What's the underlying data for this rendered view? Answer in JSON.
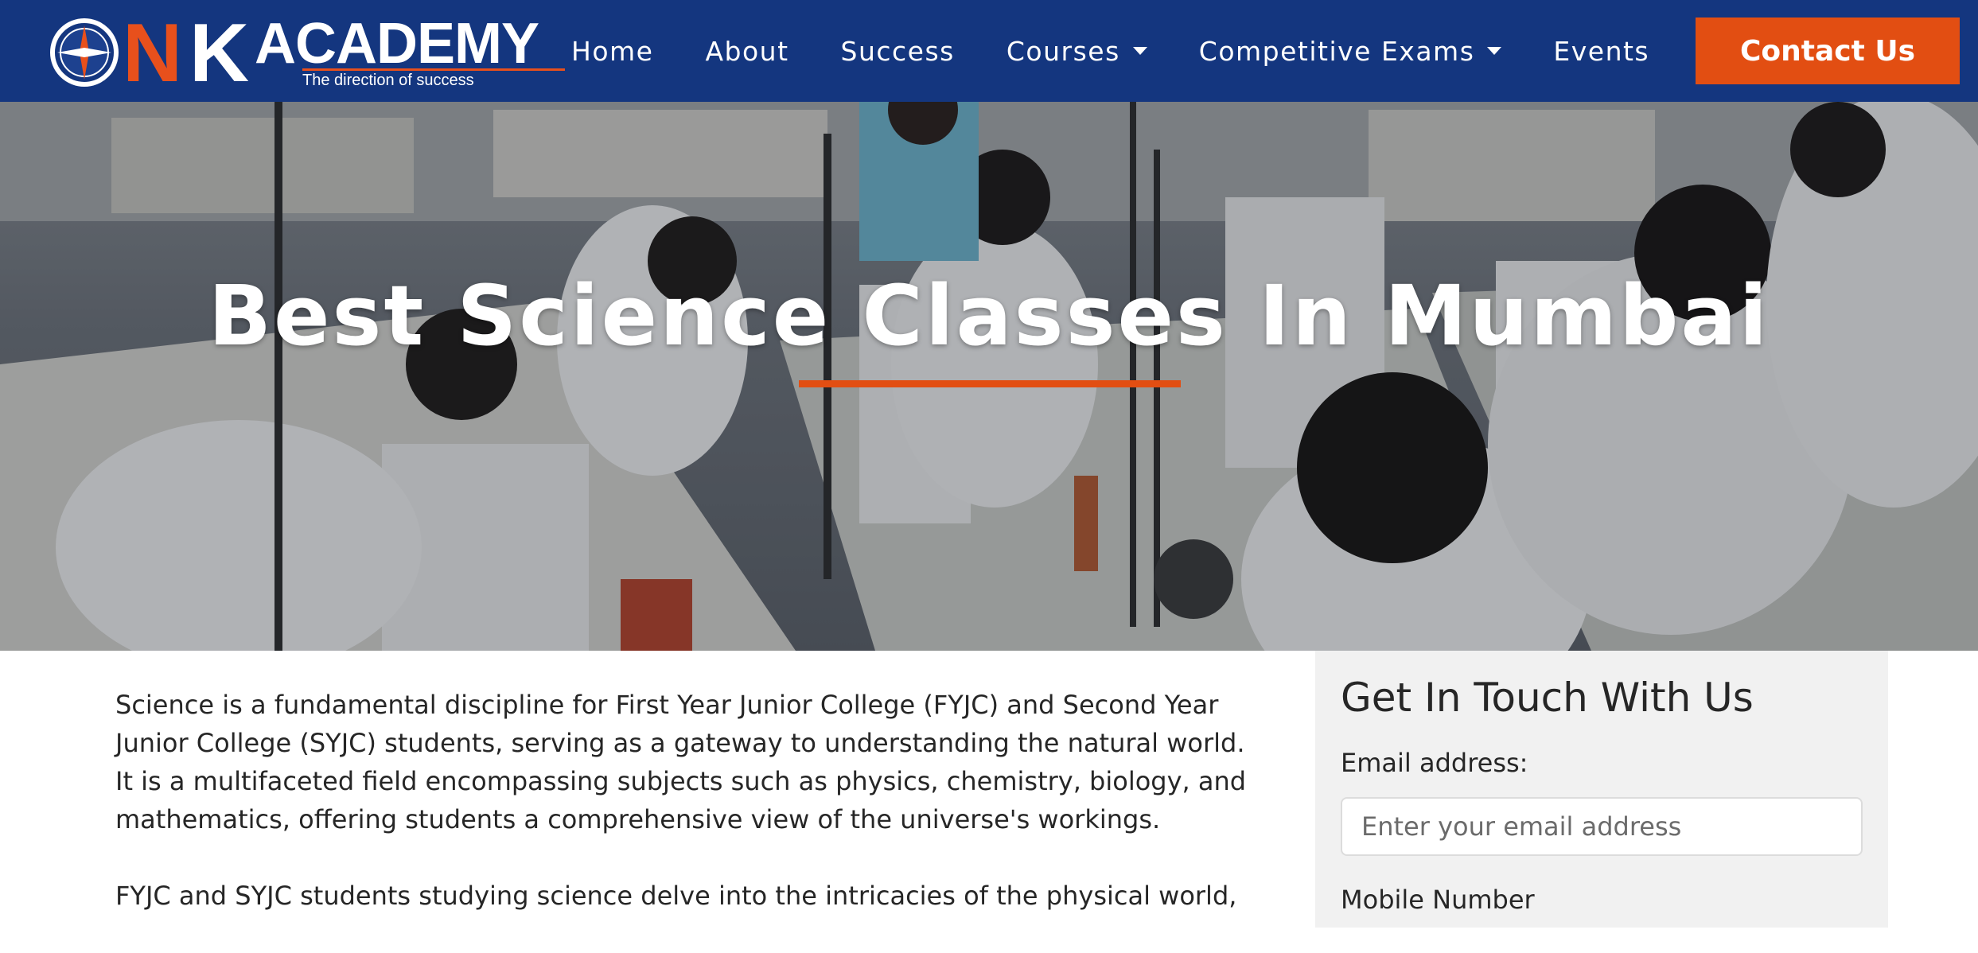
{
  "nav": {
    "logo": {
      "letter_n": "N",
      "letter_k": "K",
      "academy": "ACADEMY",
      "tagline": "The direction of success"
    },
    "items": [
      {
        "label": "Home",
        "has_dropdown": false
      },
      {
        "label": "About",
        "has_dropdown": false
      },
      {
        "label": "Success",
        "has_dropdown": false
      },
      {
        "label": "Courses",
        "has_dropdown": true
      },
      {
        "label": "Competitive Exams",
        "has_dropdown": true
      },
      {
        "label": "Events",
        "has_dropdown": false
      }
    ],
    "contact_label": "Contact Us"
  },
  "hero": {
    "title": "Best Science Classes In Mumbai",
    "image_icon": "science-lab-photo"
  },
  "content": {
    "paragraphs": [
      "Science is a fundamental discipline for First Year Junior College (FYJC) and Second Year Junior College (SYJC) students, serving as a gateway to understanding the natural world. It is a multifaceted field encompassing subjects such as physics, chemistry, biology, and mathematics, offering students a comprehensive view of the universe's workings.",
      "FYJC and SYJC students studying science delve into the intricacies of the physical world,"
    ]
  },
  "form": {
    "title": "Get In Touch With Us",
    "email_label": "Email address:",
    "email_placeholder": "Enter your email address",
    "email_value": "",
    "mobile_label": "Mobile Number"
  },
  "colors": {
    "navbar": "#14367f",
    "accent": "#e24e12",
    "form_background": "#f1f1f1"
  }
}
